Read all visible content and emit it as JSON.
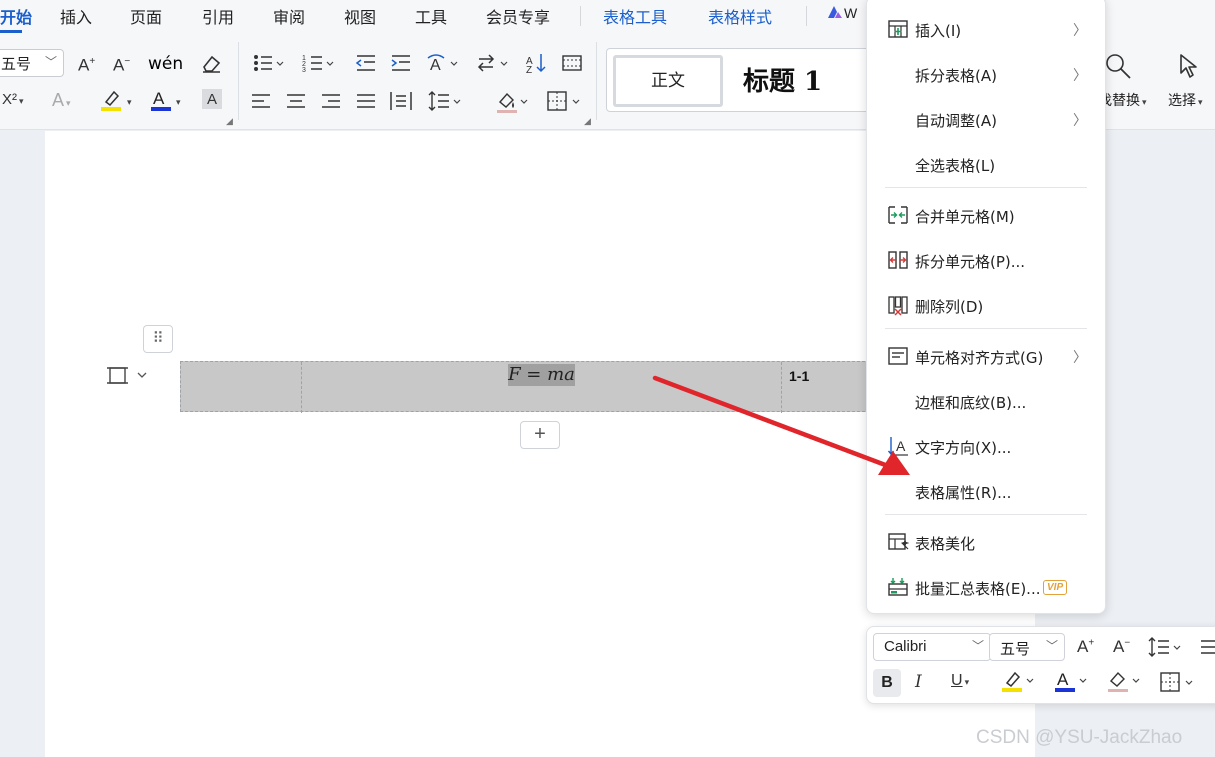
{
  "menu_tabs": {
    "start": "开始",
    "insert": "插入",
    "page": "页面",
    "reference": "引用",
    "review": "审阅",
    "view": "视图",
    "tools": "工具",
    "member": "会员专享",
    "table_tools": "表格工具",
    "table_style": "表格样式",
    "wps_ai_partial": "W"
  },
  "ribbon": {
    "font_size": "五号",
    "superscript_label": "X²",
    "style_normal": "正文",
    "style_heading": "标题 1",
    "replace_partial": "找替换",
    "select": "选择"
  },
  "document": {
    "formula": "F = ma",
    "equation_number": "1-1"
  },
  "context_menu": {
    "items": [
      {
        "label": "插入(I)",
        "has_submenu": true,
        "icon": "insert-table-icon"
      },
      {
        "label": "拆分表格(A)",
        "has_submenu": true,
        "icon": ""
      },
      {
        "label": "自动调整(A)",
        "has_submenu": true,
        "icon": ""
      },
      {
        "label": "全选表格(L)",
        "has_submenu": false,
        "icon": ""
      },
      {
        "label": "合并单元格(M)",
        "has_submenu": false,
        "icon": "merge-cells-icon"
      },
      {
        "label": "拆分单元格(P)...",
        "has_submenu": false,
        "icon": "split-cells-icon"
      },
      {
        "label": "删除列(D)",
        "has_submenu": false,
        "icon": "delete-column-icon"
      },
      {
        "label": "单元格对齐方式(G)",
        "has_submenu": true,
        "icon": "cell-align-icon"
      },
      {
        "label": "边框和底纹(B)...",
        "has_submenu": false,
        "icon": ""
      },
      {
        "label": "文字方向(X)...",
        "has_submenu": false,
        "icon": "text-direction-icon"
      },
      {
        "label": "表格属性(R)...",
        "has_submenu": false,
        "icon": ""
      },
      {
        "label": "表格美化",
        "has_submenu": false,
        "icon": "table-beautify-icon"
      },
      {
        "label": "批量汇总表格(E)...",
        "has_submenu": false,
        "icon": "batch-summary-icon",
        "badge": "VIP"
      }
    ]
  },
  "mini_toolbar": {
    "font_name": "Calibri",
    "font_size": "五号",
    "bold": "B",
    "italic": "I",
    "underline": "U"
  },
  "watermark": "CSDN @YSU-JackZhao",
  "colors": {
    "accent": "#1a5fcc",
    "arrow": "#e0252b",
    "table_fill": "#c8c8c8",
    "highlight_yellow": "#f5e100",
    "font_color_blue": "#1b34d6"
  }
}
